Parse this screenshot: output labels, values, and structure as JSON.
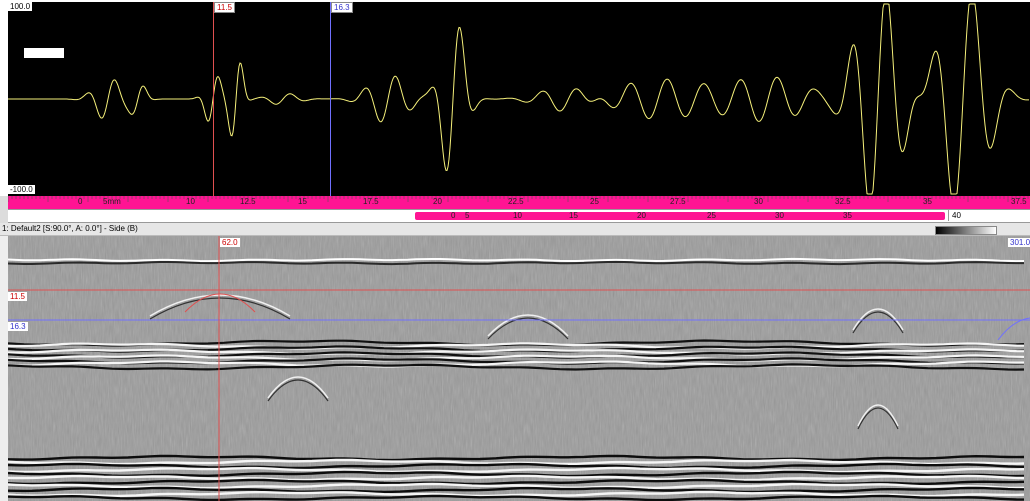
{
  "ascan": {
    "y_max_label": "100.0",
    "y_min_label": "-100.0",
    "cursor_red_label": "11.5",
    "cursor_blue_label": "16.3",
    "red_color": "#e05050",
    "blue_color": "#7070ff",
    "signal_color": "#f5f07a"
  },
  "ruler": {
    "ticks": [
      "0",
      "5mm",
      "10",
      "12.5",
      "15",
      "17.5",
      "20",
      "22.5",
      "25",
      "27.5",
      "30",
      "32.5",
      "35",
      "37.5"
    ]
  },
  "gate": {
    "ticks": [
      "0",
      "5",
      "10",
      "15",
      "20",
      "25",
      "30",
      "35"
    ],
    "end_label": "40"
  },
  "bscan": {
    "title": "1: Default2 [S:90.0°, A: 0.0°] - Side (B)",
    "cursor_top_label": "62.0",
    "right_label": "301.0",
    "red_line_label": "11.5",
    "blue_line_label": "16.3"
  }
}
